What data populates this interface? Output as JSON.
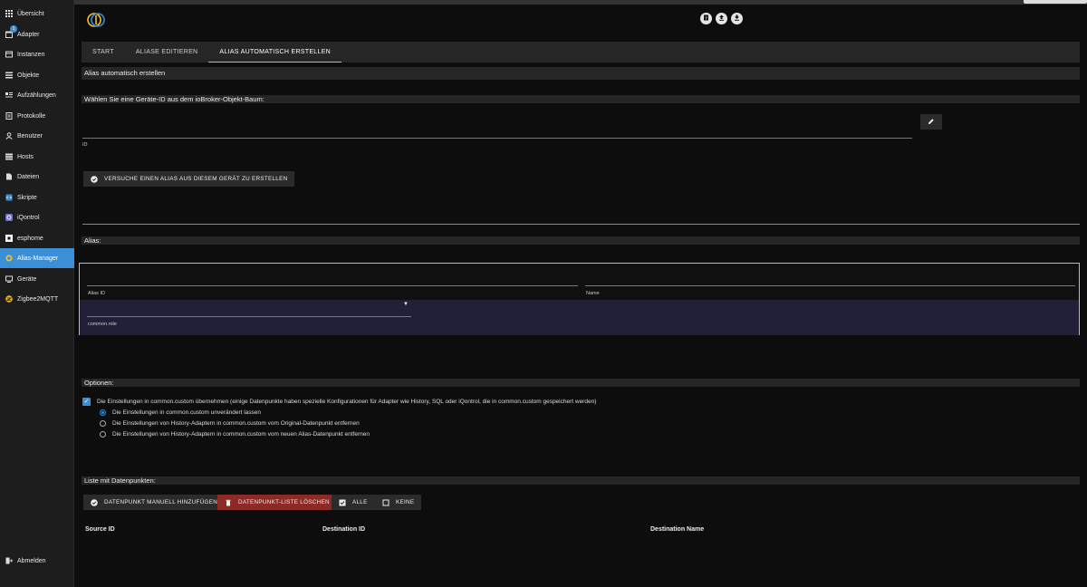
{
  "sidebar": {
    "items": [
      {
        "label": "Übersicht",
        "icon": "grid-icon"
      },
      {
        "label": "Adapter",
        "icon": "store-icon",
        "badge": "1"
      },
      {
        "label": "Instanzen",
        "icon": "instances-icon"
      },
      {
        "label": "Objekte",
        "icon": "list-icon"
      },
      {
        "label": "Aufzählungen",
        "icon": "enum-icon"
      },
      {
        "label": "Protokolle",
        "icon": "log-icon"
      },
      {
        "label": "Benutzer",
        "icon": "user-icon"
      },
      {
        "label": "Hosts",
        "icon": "hosts-icon"
      },
      {
        "label": "Dateien",
        "icon": "file-icon"
      },
      {
        "label": "Skripte",
        "icon": "script-icon"
      },
      {
        "label": "iQontrol",
        "icon": "iqontrol-icon"
      },
      {
        "label": "esphome",
        "icon": "esphome-icon"
      },
      {
        "label": "Alias-Manager",
        "icon": "alias-manager-icon"
      },
      {
        "label": "Geräte",
        "icon": "devices-icon"
      },
      {
        "label": "Zigbee2MQTT",
        "icon": "zigbee-icon"
      }
    ],
    "logout": "Abmelden"
  },
  "colors": {
    "accent": "#3a8fd6",
    "danger": "#8c2a26",
    "panel": "#262626"
  },
  "tabs": [
    "START",
    "ALIASE EDITIEREN",
    "ALIAS AUTOMATISCH ERSTELLEN"
  ],
  "page": {
    "title": "Alias automatisch erstellen",
    "select_device_heading": "Wählen Sie eine Geräte-ID aus dem ioBroker-Objekt-Baum:",
    "id_label": "ID",
    "try_button": "VERSUCHE EINEN ALIAS AUS DIESEM GERÄT ZU ERSTELLEN",
    "alias_heading": "Alias:",
    "alias_id_label": "Alias ID",
    "name_label": "Name",
    "role_label": "common.role",
    "options_heading": "Optionen:",
    "option_main": "Die Einstellungen in common.custom übernehmen (einige Datenpunkte haben spezielle Konfigurationen für Adapter wie History, SQL oder iQontrol, die in common.custom gespeichert werden)",
    "option_radios": [
      "Die Einstellungen in common.custom unverändert lassen",
      "Die Einstellungen von History-Adaptern in common.custom vom Original-Datenpunkt entfernen",
      "Die Einstellungen von History-Adaptern in common.custom vom neuen Alias-Datenpunkt entfernen"
    ],
    "list_heading": "Liste mit Datenpunkten:",
    "buttons": {
      "add_manual": "DATENPUNKT MANUELL HINZUFÜGEN",
      "clear_list": "DATENPUNKT-LISTE LÖSCHEN",
      "all": "ALLE",
      "none": "KEINE"
    },
    "table_headers": [
      "Source ID",
      "Destination ID",
      "Destination Name"
    ]
  }
}
